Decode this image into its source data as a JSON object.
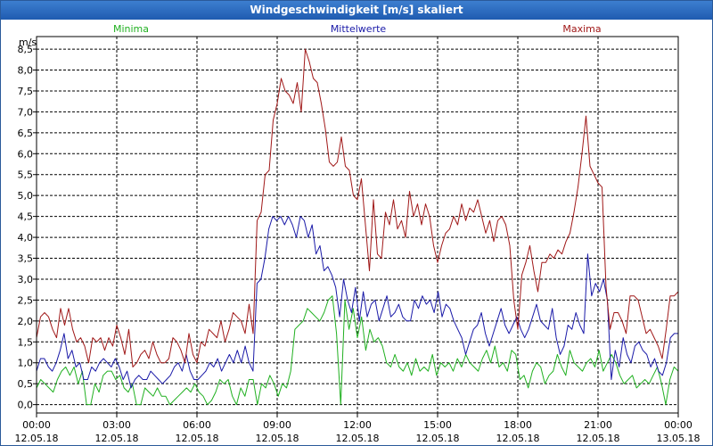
{
  "window": {
    "title": "Windgeschwindigkeit [m/s] skaliert"
  },
  "colors": {
    "minima": "#20b020",
    "mittelwerte": "#1a1aa8",
    "maxima": "#a01818",
    "grid": "#000000",
    "titlebar": "#2a68c0"
  },
  "chart_data": {
    "type": "line",
    "title": "Windgeschwindigkeit [m/s] skaliert",
    "ylabel": "m/s",
    "ylim": [
      -0.2,
      8.8
    ],
    "yticks": [
      "0,0",
      "0,5",
      "1,0",
      "1,5",
      "2,0",
      "2,5",
      "3,0",
      "3,5",
      "4,0",
      "4,5",
      "5,0",
      "5,5",
      "6,0",
      "6,5",
      "7,0",
      "7,5",
      "8,0",
      "8,5"
    ],
    "xticks": [
      {
        "time": "00:00",
        "date": "12.05.18"
      },
      {
        "time": "03:00",
        "date": "12.05.18"
      },
      {
        "time": "06:00",
        "date": "12.05.18"
      },
      {
        "time": "09:00",
        "date": "12.05.18"
      },
      {
        "time": "12:00",
        "date": "12.05.18"
      },
      {
        "time": "15:00",
        "date": "12.05.18"
      },
      {
        "time": "18:00",
        "date": "12.05.18"
      },
      {
        "time": "21:00",
        "date": "12.05.18"
      },
      {
        "time": "00:00",
        "date": "13.05.18"
      }
    ],
    "grid": true,
    "legend": [
      "Minima",
      "Mittelwerte",
      "Maxima"
    ],
    "series": [
      {
        "name": "Minima",
        "values": [
          0.4,
          0.6,
          0.5,
          0.4,
          0.3,
          0.6,
          0.8,
          0.9,
          0.7,
          0.9,
          0.5,
          0.8,
          0.0,
          0.0,
          0.5,
          0.3,
          0.7,
          0.8,
          0.8,
          0.6,
          0.7,
          0.4,
          0.3,
          0.5,
          0.0,
          0.0,
          0.4,
          0.3,
          0.2,
          0.4,
          0.2,
          0.2,
          0.0,
          0.1,
          0.2,
          0.3,
          0.4,
          0.3,
          0.5,
          0.3,
          0.2,
          0.0,
          0.1,
          0.3,
          0.6,
          0.5,
          0.6,
          0.2,
          0.0,
          0.4,
          0.2,
          0.6,
          0.6,
          0.0,
          0.5,
          0.4,
          0.7,
          0.5,
          0.2,
          0.5,
          0.4,
          0.8,
          1.8,
          1.9,
          2.0,
          2.3,
          2.2,
          2.1,
          2.0,
          2.2,
          2.5,
          2.6,
          1.7,
          0.0,
          2.5,
          1.8,
          2.3,
          1.6,
          2.1,
          1.3,
          1.8,
          1.5,
          1.6,
          1.4,
          1.0,
          0.9,
          1.2,
          0.9,
          0.8,
          1.0,
          0.7,
          1.1,
          0.8,
          0.9,
          0.8,
          1.2,
          0.7,
          1.0,
          0.9,
          1.0,
          0.8,
          1.1,
          0.9,
          1.2,
          1.0,
          0.9,
          0.8,
          1.1,
          1.3,
          1.0,
          1.4,
          0.9,
          1.0,
          0.8,
          1.3,
          1.2,
          0.6,
          0.7,
          0.4,
          0.8,
          1.0,
          0.9,
          0.5,
          0.7,
          0.8,
          1.2,
          0.9,
          0.7,
          1.3,
          1.0,
          0.9,
          0.8,
          1.0,
          1.1,
          0.9,
          1.3,
          0.8,
          1.0,
          1.2,
          1.0,
          0.7,
          0.5,
          0.6,
          0.7,
          0.4,
          0.5,
          0.6,
          0.5,
          0.7,
          0.9,
          0.5,
          0.0,
          0.6,
          0.9,
          0.8
        ]
      },
      {
        "name": "Mittelwerte",
        "values": [
          0.8,
          1.1,
          1.1,
          0.9,
          0.8,
          1.0,
          1.3,
          1.7,
          1.1,
          1.3,
          0.9,
          1.0,
          0.6,
          0.6,
          0.9,
          0.8,
          1.0,
          1.1,
          1.0,
          0.9,
          1.1,
          0.9,
          0.6,
          0.8,
          0.4,
          0.6,
          0.7,
          0.6,
          0.6,
          0.8,
          0.7,
          0.6,
          0.5,
          0.6,
          0.7,
          0.9,
          1.0,
          0.8,
          1.2,
          0.8,
          0.6,
          0.6,
          0.7,
          0.8,
          1.0,
          0.9,
          1.1,
          0.8,
          1.0,
          1.2,
          1.0,
          1.3,
          1.0,
          1.4,
          1.0,
          0.8,
          2.9,
          3.0,
          3.5,
          4.2,
          4.5,
          4.4,
          4.5,
          4.3,
          4.5,
          4.3,
          4.0,
          4.5,
          4.4,
          4.0,
          4.3,
          3.6,
          3.8,
          3.2,
          3.3,
          3.1,
          2.8,
          2.1,
          3.0,
          2.5,
          2.2,
          2.8,
          2.0,
          2.7,
          2.1,
          2.4,
          2.5,
          2.0,
          2.3,
          2.6,
          2.1,
          2.2,
          2.4,
          2.1,
          2.0,
          2.0,
          2.5,
          2.3,
          2.6,
          2.4,
          2.5,
          2.2,
          2.7,
          2.1,
          2.4,
          2.3,
          2.0,
          1.8,
          1.6,
          1.2,
          1.5,
          1.8,
          1.9,
          2.2,
          1.7,
          1.4,
          1.7,
          2.0,
          2.3,
          1.9,
          1.7,
          1.9,
          2.1,
          1.8,
          1.6,
          1.8,
          2.1,
          2.4,
          2.0,
          1.9,
          1.8,
          2.3,
          1.6,
          1.2,
          1.4,
          1.9,
          1.8,
          2.2,
          1.9,
          1.7,
          3.6,
          2.6,
          2.9,
          2.7,
          3.0,
          2.5,
          0.6,
          1.3,
          0.9,
          1.6,
          1.2,
          1.0,
          1.4,
          1.5,
          1.3,
          1.2,
          0.9,
          1.1,
          0.8,
          0.7,
          1.0,
          1.6,
          1.7,
          1.7
        ]
      },
      {
        "name": "Maxima",
        "values": [
          1.6,
          2.1,
          2.2,
          2.1,
          1.8,
          1.6,
          2.3,
          1.9,
          2.3,
          1.8,
          1.5,
          1.6,
          1.4,
          1.0,
          1.6,
          1.5,
          1.6,
          1.3,
          1.6,
          1.4,
          1.9,
          1.6,
          1.2,
          1.8,
          0.9,
          1.0,
          1.2,
          1.3,
          1.1,
          1.5,
          1.2,
          1.0,
          1.0,
          1.1,
          1.6,
          1.5,
          1.3,
          1.0,
          1.7,
          1.2,
          1.0,
          1.5,
          1.4,
          1.8,
          1.7,
          1.6,
          2.0,
          1.5,
          1.8,
          2.2,
          2.1,
          2.0,
          1.7,
          2.4,
          1.7,
          4.4,
          4.6,
          5.5,
          5.6,
          6.8,
          7.2,
          7.8,
          7.5,
          7.4,
          7.2,
          7.7,
          7.0,
          8.5,
          8.2,
          7.8,
          7.7,
          7.2,
          6.6,
          5.8,
          5.7,
          5.8,
          6.4,
          5.7,
          5.6,
          5.0,
          4.9,
          5.4,
          4.3,
          3.2,
          4.9,
          3.6,
          3.5,
          4.6,
          4.3,
          4.9,
          4.2,
          4.4,
          4.0,
          5.1,
          4.5,
          4.8,
          4.3,
          4.8,
          4.5,
          3.8,
          3.4,
          3.8,
          4.1,
          4.2,
          4.5,
          4.3,
          4.8,
          4.4,
          4.7,
          4.6,
          4.9,
          4.5,
          4.1,
          4.4,
          3.9,
          4.4,
          4.5,
          4.3,
          3.8,
          2.5,
          1.8,
          3.1,
          3.4,
          3.8,
          3.2,
          2.7,
          3.4,
          3.4,
          3.6,
          3.5,
          3.7,
          3.6,
          3.9,
          4.1,
          4.6,
          5.2,
          6.0,
          6.9,
          5.7,
          5.5,
          5.3,
          5.2,
          2.8,
          1.8,
          2.2,
          2.2,
          2.0,
          1.7,
          2.6,
          2.6,
          2.5,
          2.1,
          1.7,
          1.8,
          1.6,
          1.4,
          1.1,
          1.8,
          2.6,
          2.6,
          2.7
        ]
      }
    ]
  }
}
